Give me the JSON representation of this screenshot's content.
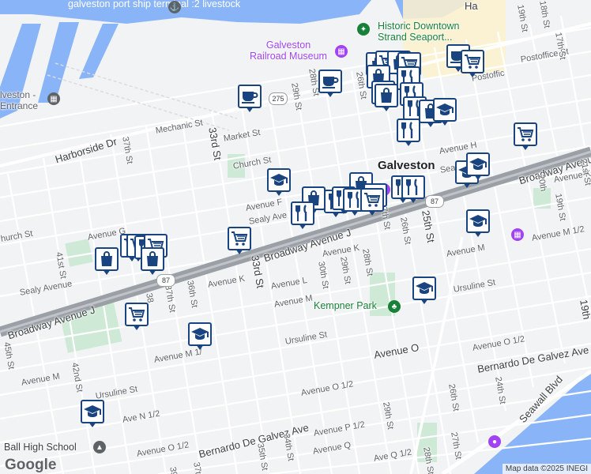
{
  "map": {
    "branding": "Google",
    "attribution": "Map data ©2025 INEGI",
    "pois": {
      "port_ship_terminal": "galveston port ship\nterminal :2 livestock",
      "railroad_museum": "Galveston\nRailroad Museum",
      "historic_downtown": "Historic Downtown\nStrand Seaport...",
      "port_entrance": "lveston -\nEntrance",
      "kempner_park": "Kempner Park",
      "ball_high_school": "Ball High School",
      "city": "Galveston"
    },
    "streets": {
      "harborside": "Harborside Dr",
      "mechanic": "Mechanic St",
      "market": "Market St",
      "church": "Church St",
      "church_west": "hurch St",
      "postoffice": "Postoffice St",
      "postoffice_2": "Postoffic",
      "avenue_h": "Avenue H",
      "sea": "Sea",
      "broadway_east": "Broadway Avenue",
      "broadway_mid": "Broadway Avenue J",
      "broadway_west": "Broadway Avenue J",
      "avenue_k": "Avenue K",
      "avenue_k_east": "Avenue K",
      "avenue_k_west": "Avenue K",
      "avenue_l": "Avenue L",
      "avenue_m": "Avenue M",
      "avenue_m_west": "Avenue M",
      "avenue_m_east": "Avenue M",
      "avenue_m_half": "Avenue M 1/",
      "avenue_m_half_east": "Avenue M 1/2",
      "ursuline": "Ursuline St",
      "ursuline_east": "Ursuline St",
      "ursuline_west": "Ursuline St",
      "avenue_n_half": "Ave N 1/2",
      "avenue_o": "Avenue O",
      "avenue_o_half_east": "Avenue O 1/2",
      "avenue_o_half": "Avenue O 1/2",
      "avenue_o_half_west": "Avenue O 1/2",
      "bernardo_east": "Bernardo De Galvez Ave",
      "bernardo_west": "Bernardo De Galvez Ave",
      "avenue_p_half": "Avenue P 1/2",
      "avenue_q": "Avenue Q",
      "avenue_q_half": "Ave Q 1/2",
      "seawall": "Seawall Blvd",
      "sealy": "Sealy Avenue",
      "sealy_mid": "Sealy Ave",
      "avenue_g": "Avenue G",
      "avenue_f": "Avenue F",
      "avenue_f_east": "Avenue K",
      "ha": "Ha",
      "s41": "41st St",
      "s42": "42nd St",
      "s45": "45th St",
      "s37": "37th St",
      "s37b": "37th St",
      "s37c": "37th",
      "s36": "36th St",
      "s38": "38",
      "s35": "35th St",
      "s34": "34th St",
      "s33": "33rd St",
      "s33b": "33rd St",
      "s30": "30th St",
      "s29": "29th St",
      "s29b": "29th St",
      "s29c": "29th St",
      "s28": "28th St",
      "s28b": "28th St",
      "s28c": "28th St",
      "s27": "27th St",
      "s27b": "27th St",
      "s26": "26th St",
      "s26b": "26th St",
      "s26c": "26th St",
      "s25": "25th St",
      "s24": "24th St",
      "s19": "19th St",
      "s19b": "19th St",
      "s19c": "19th",
      "s18": "18th St",
      "s17": "17th St",
      "s20": "20th",
      "s21": "21st St",
      "s39": "39"
    },
    "shields": [
      "275",
      "87",
      "87"
    ],
    "icons": {
      "coffee": "coffee-cup-icon",
      "shopping": "shopping-bag-icon",
      "restaurant": "fork-knife-icon",
      "grocery": "shopping-cart-icon",
      "school": "graduation-cap-icon"
    },
    "colors": {
      "land": "#f1f3f4",
      "water": "#8ab4f8",
      "park": "#ceead6",
      "highway": "#9aa0a6",
      "pin_border": "#1a4480",
      "downtown": "#fdf1cc"
    }
  }
}
